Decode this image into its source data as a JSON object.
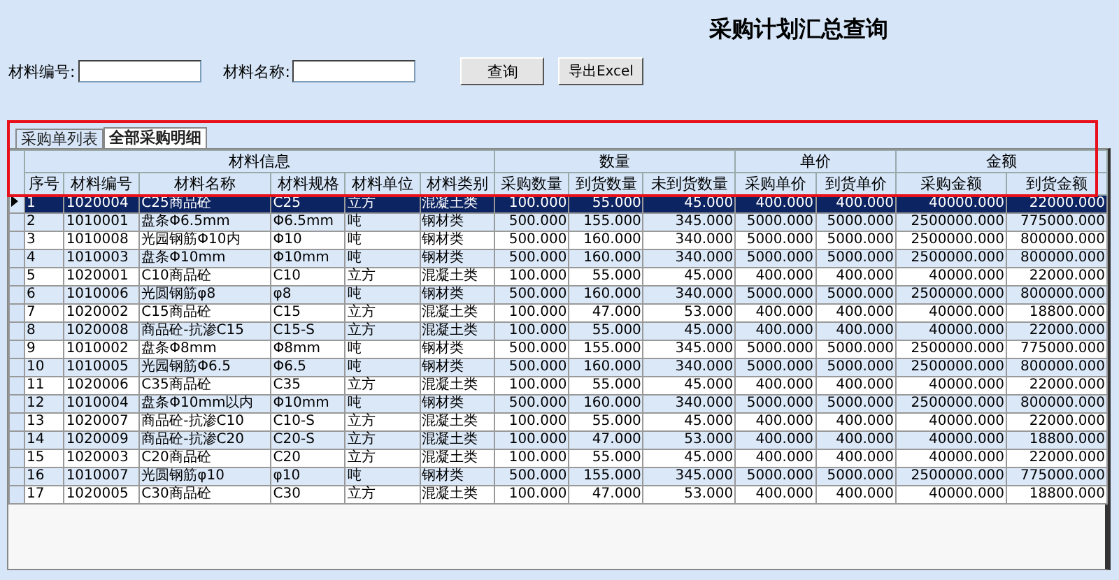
{
  "title": "采购计划汇总查询",
  "filters": [
    {
      "label": "材料编号:"
    },
    {
      "label": "材料名称:"
    }
  ],
  "buttons": [
    "查询",
    "导出Excel"
  ],
  "tabs": [
    {
      "label": "采购单列表",
      "selected": false
    },
    {
      "label": "全部采购明细",
      "selected": true
    }
  ],
  "table": {
    "groups": [
      {
        "label": "材料信息",
        "columns": [
          "序号",
          "材料编号",
          "材料名称",
          "材料规格",
          "材料单位",
          "材料类别"
        ]
      },
      {
        "label": "数量",
        "columns": [
          "采购数量",
          "到货数量",
          "未到货数量"
        ]
      },
      {
        "label": "单价",
        "columns": [
          "采购单价",
          "到货单价"
        ]
      },
      {
        "label": "金额",
        "columns": [
          "采购金额",
          "到货金额"
        ]
      }
    ],
    "rows": [
      {
        "selected": true,
        "cells": [
          "1",
          "1020004",
          "C25商品砼",
          "C25",
          "立方",
          "混凝土类",
          "100.000",
          "55.000",
          "45.000",
          "400.000",
          "400.000",
          "40000.000",
          "22000.000"
        ]
      },
      {
        "selected": false,
        "cells": [
          "2",
          "1010001",
          "盘条Φ6.5mm",
          "Φ6.5mm",
          "吨",
          "钢材类",
          "500.000",
          "155.000",
          "345.000",
          "5000.000",
          "5000.000",
          "2500000.000",
          "775000.000"
        ]
      },
      {
        "selected": false,
        "cells": [
          "3",
          "1010008",
          "光园钢筋Φ10内",
          "Φ10",
          "吨",
          "钢材类",
          "500.000",
          "160.000",
          "340.000",
          "5000.000",
          "5000.000",
          "2500000.000",
          "800000.000"
        ]
      },
      {
        "selected": false,
        "cells": [
          "4",
          "1010003",
          "盘条Φ10mm",
          "Φ10mm",
          "吨",
          "钢材类",
          "500.000",
          "160.000",
          "340.000",
          "5000.000",
          "5000.000",
          "2500000.000",
          "800000.000"
        ]
      },
      {
        "selected": false,
        "cells": [
          "5",
          "1020001",
          "C10商品砼",
          "C10",
          "立方",
          "混凝土类",
          "100.000",
          "55.000",
          "45.000",
          "400.000",
          "400.000",
          "40000.000",
          "22000.000"
        ]
      },
      {
        "selected": false,
        "cells": [
          "6",
          "1010006",
          "光圆钢筋φ8",
          "φ8",
          "吨",
          "钢材类",
          "500.000",
          "160.000",
          "340.000",
          "5000.000",
          "5000.000",
          "2500000.000",
          "800000.000"
        ]
      },
      {
        "selected": false,
        "cells": [
          "7",
          "1020002",
          "C15商品砼",
          "C15",
          "立方",
          "混凝土类",
          "100.000",
          "47.000",
          "53.000",
          "400.000",
          "400.000",
          "40000.000",
          "18800.000"
        ]
      },
      {
        "selected": false,
        "cells": [
          "8",
          "1020008",
          "商品砼-抗渗C15",
          "C15-S",
          "立方",
          "混凝土类",
          "100.000",
          "55.000",
          "45.000",
          "400.000",
          "400.000",
          "40000.000",
          "22000.000"
        ]
      },
      {
        "selected": false,
        "cells": [
          "9",
          "1010002",
          "盘条Φ8mm",
          "Φ8mm",
          "吨",
          "钢材类",
          "500.000",
          "155.000",
          "345.000",
          "5000.000",
          "5000.000",
          "2500000.000",
          "775000.000"
        ]
      },
      {
        "selected": false,
        "cells": [
          "10",
          "1010005",
          "光园钢筋Φ6.5",
          "Φ6.5",
          "吨",
          "钢材类",
          "500.000",
          "160.000",
          "340.000",
          "5000.000",
          "5000.000",
          "2500000.000",
          "800000.000"
        ]
      },
      {
        "selected": false,
        "cells": [
          "11",
          "1020006",
          "C35商品砼",
          "C35",
          "立方",
          "混凝土类",
          "100.000",
          "55.000",
          "45.000",
          "400.000",
          "400.000",
          "40000.000",
          "22000.000"
        ]
      },
      {
        "selected": false,
        "cells": [
          "12",
          "1010004",
          "盘条Φ10mm以内",
          "Φ10mm",
          "吨",
          "钢材类",
          "500.000",
          "160.000",
          "340.000",
          "5000.000",
          "5000.000",
          "2500000.000",
          "800000.000"
        ]
      },
      {
        "selected": false,
        "cells": [
          "13",
          "1020007",
          "商品砼-抗渗C10",
          "C10-S",
          "立方",
          "混凝土类",
          "100.000",
          "55.000",
          "45.000",
          "400.000",
          "400.000",
          "40000.000",
          "22000.000"
        ]
      },
      {
        "selected": false,
        "cells": [
          "14",
          "1020009",
          "商品砼-抗渗C20",
          "C20-S",
          "立方",
          "混凝土类",
          "100.000",
          "47.000",
          "53.000",
          "400.000",
          "400.000",
          "40000.000",
          "18800.000"
        ]
      },
      {
        "selected": false,
        "cells": [
          "15",
          "1020003",
          "C20商品砼",
          "C20",
          "立方",
          "混凝土类",
          "100.000",
          "55.000",
          "45.000",
          "400.000",
          "400.000",
          "40000.000",
          "22000.000"
        ]
      },
      {
        "selected": false,
        "cells": [
          "16",
          "1010007",
          "光圆钢筋φ10",
          "φ10",
          "吨",
          "钢材类",
          "500.000",
          "155.000",
          "345.000",
          "5000.000",
          "5000.000",
          "2500000.000",
          "775000.000"
        ]
      },
      {
        "selected": false,
        "cells": [
          "17",
          "1020005",
          "C30商品砼",
          "C30",
          "立方",
          "混凝土类",
          "100.000",
          "47.000",
          "53.000",
          "400.000",
          "400.000",
          "40000.000",
          "18800.000"
        ]
      }
    ]
  }
}
